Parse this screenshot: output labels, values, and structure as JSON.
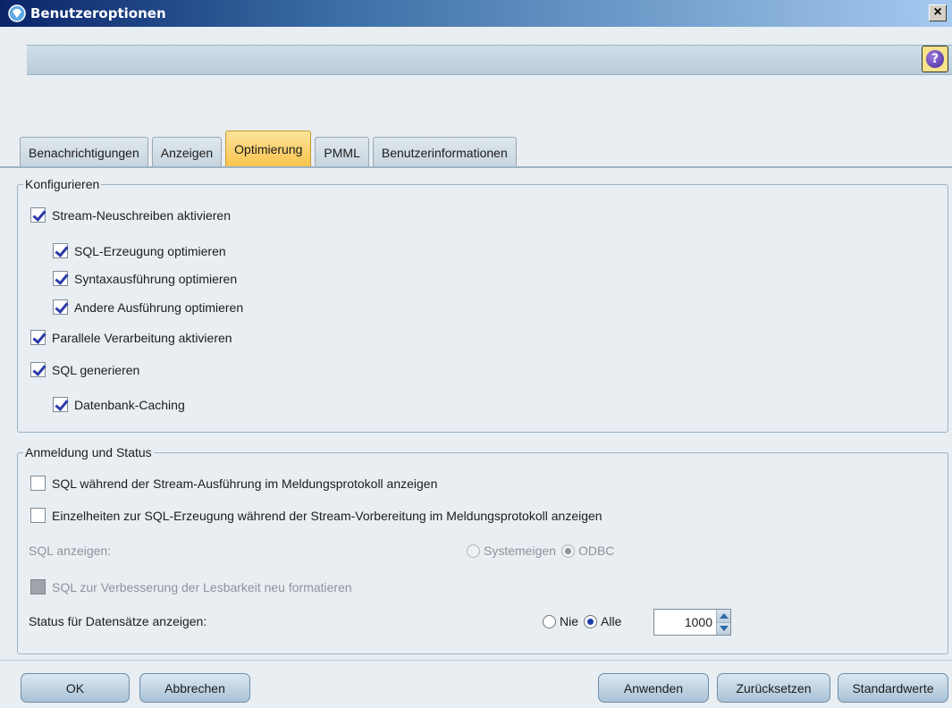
{
  "window": {
    "title": "Benutzeroptionen",
    "close_label": "×",
    "help_label": "?"
  },
  "tabs": [
    {
      "label": "Benachrichtigungen",
      "active": false
    },
    {
      "label": "Anzeigen",
      "active": false
    },
    {
      "label": "Optimierung",
      "active": true
    },
    {
      "label": "PMML",
      "active": false
    },
    {
      "label": "Benutzerinformationen",
      "active": false
    }
  ],
  "configure": {
    "legend": "Konfigurieren",
    "stream_rewrite": {
      "label": "Stream-Neuschreiben aktivieren",
      "checked": true
    },
    "sql_optimize": {
      "label": "SQL-Erzeugung optimieren",
      "checked": true
    },
    "syntax_optimize": {
      "label": "Syntaxausführung optimieren",
      "checked": true
    },
    "other_optimize": {
      "label": "Andere Ausführung optimieren",
      "checked": true
    },
    "parallel": {
      "label": "Parallele Verarbeitung aktivieren",
      "checked": true
    },
    "sql_generate": {
      "label": "SQL generieren",
      "checked": true
    },
    "db_caching": {
      "label": "Datenbank-Caching",
      "checked": true
    }
  },
  "logging": {
    "legend": "Anmeldung und Status",
    "show_sql_log": {
      "label": "SQL während der Stream-Ausführung im Meldungsprotokoll anzeigen",
      "checked": false
    },
    "show_details": {
      "label": "Einzelheiten zur SQL-Erzeugung während der Stream-Vorbereitung im Meldungsprotokoll anzeigen",
      "checked": false
    },
    "sql_display_label": "SQL anzeigen:",
    "sql_display_options": [
      {
        "label": "Systemeigen",
        "selected": false
      },
      {
        "label": "ODBC",
        "selected": true
      }
    ],
    "reformat": {
      "label": "SQL zur Verbesserung der Lesbarkeit neu formatieren",
      "checked": false,
      "disabled": true
    },
    "status_label": "Status für Datensätze anzeigen:",
    "status_options": [
      {
        "label": "Nie",
        "selected": false
      },
      {
        "label": "Alle",
        "selected": true
      }
    ],
    "status_value": "1000"
  },
  "buttons": {
    "ok": "OK",
    "cancel": "Abbrechen",
    "apply": "Anwenden",
    "reset": "Zurücksetzen",
    "defaults": "Standardwerte"
  },
  "colors": {
    "active_tab": "#f9c34c",
    "checkmark": "#2b3aa8",
    "button_blue": "#a9c2d6"
  }
}
